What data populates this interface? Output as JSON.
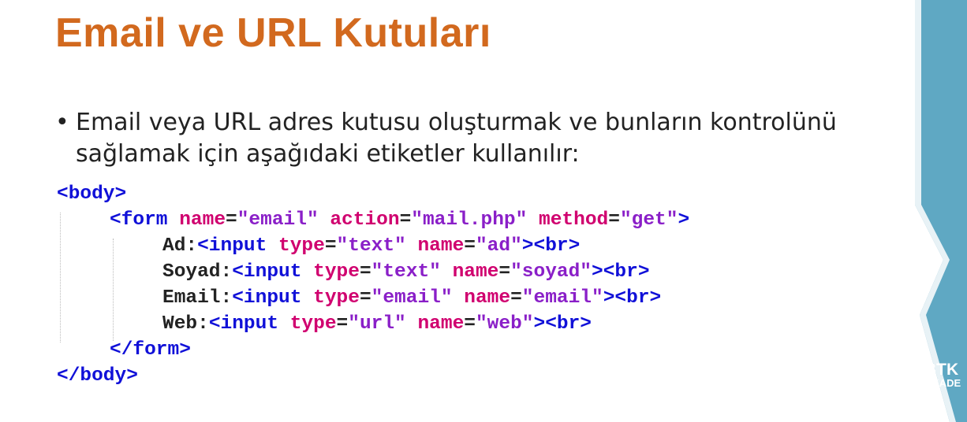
{
  "title": "Email ve URL Kutuları",
  "bullet": {
    "symbol": "•",
    "line1": "Email veya URL adres kutusu oluşturmak ve bunların kontrolünü",
    "line2": "sağlamak için aşağıdaki etiketler kullanılır:"
  },
  "code_lines": [
    [
      {
        "t": "tag",
        "v": "<body>"
      }
    ],
    [
      {
        "t": "tag",
        "v": "<form"
      },
      {
        "t": "txt",
        "v": " "
      },
      {
        "t": "attr",
        "v": "name"
      },
      {
        "t": "txt",
        "v": "="
      },
      {
        "t": "val",
        "v": "\"email\""
      },
      {
        "t": "txt",
        "v": " "
      },
      {
        "t": "attr",
        "v": "action"
      },
      {
        "t": "txt",
        "v": "="
      },
      {
        "t": "val",
        "v": "\"mail.php\""
      },
      {
        "t": "txt",
        "v": " "
      },
      {
        "t": "attr",
        "v": "method"
      },
      {
        "t": "txt",
        "v": "="
      },
      {
        "t": "val",
        "v": "\"get\""
      },
      {
        "t": "tag",
        "v": ">"
      }
    ],
    [
      {
        "t": "txt",
        "v": "Ad:"
      },
      {
        "t": "tag",
        "v": "<input"
      },
      {
        "t": "txt",
        "v": " "
      },
      {
        "t": "attr",
        "v": "type"
      },
      {
        "t": "txt",
        "v": "="
      },
      {
        "t": "val",
        "v": "\"text\""
      },
      {
        "t": "txt",
        "v": " "
      },
      {
        "t": "attr",
        "v": "name"
      },
      {
        "t": "txt",
        "v": "="
      },
      {
        "t": "val",
        "v": "\"ad\""
      },
      {
        "t": "tag",
        "v": "><br>"
      }
    ],
    [
      {
        "t": "txt",
        "v": "Soyad:"
      },
      {
        "t": "tag",
        "v": "<input"
      },
      {
        "t": "txt",
        "v": " "
      },
      {
        "t": "attr",
        "v": "type"
      },
      {
        "t": "txt",
        "v": "="
      },
      {
        "t": "val",
        "v": "\"text\""
      },
      {
        "t": "txt",
        "v": " "
      },
      {
        "t": "attr",
        "v": "name"
      },
      {
        "t": "txt",
        "v": "="
      },
      {
        "t": "val",
        "v": "\"soyad\""
      },
      {
        "t": "tag",
        "v": "><br>"
      }
    ],
    [
      {
        "t": "txt",
        "v": "Email:"
      },
      {
        "t": "tag",
        "v": "<input"
      },
      {
        "t": "txt",
        "v": " "
      },
      {
        "t": "attr",
        "v": "type"
      },
      {
        "t": "txt",
        "v": "="
      },
      {
        "t": "val",
        "v": "\"email\""
      },
      {
        "t": "txt",
        "v": " "
      },
      {
        "t": "attr",
        "v": "name"
      },
      {
        "t": "txt",
        "v": "="
      },
      {
        "t": "val",
        "v": "\"email\""
      },
      {
        "t": "tag",
        "v": "><br>"
      }
    ],
    [
      {
        "t": "txt",
        "v": "Web:"
      },
      {
        "t": "tag",
        "v": "<input"
      },
      {
        "t": "txt",
        "v": " "
      },
      {
        "t": "attr",
        "v": "type"
      },
      {
        "t": "txt",
        "v": "="
      },
      {
        "t": "val",
        "v": "\"url\""
      },
      {
        "t": "txt",
        "v": " "
      },
      {
        "t": "attr",
        "v": "name"
      },
      {
        "t": "txt",
        "v": "="
      },
      {
        "t": "val",
        "v": "\"web\""
      },
      {
        "t": "tag",
        "v": "><br>"
      }
    ],
    [
      {
        "t": "tag",
        "v": "</form>"
      }
    ],
    [
      {
        "t": "tag",
        "v": "</body>"
      }
    ]
  ],
  "code_indent_levels": [
    0,
    1,
    2,
    2,
    2,
    2,
    1,
    0
  ],
  "logo": {
    "line1": "BTK",
    "line2": "AKADE"
  },
  "colors": {
    "title": "#d2691e",
    "tag": "#1010d8",
    "attr": "#d0006f",
    "value": "#8a1fc8",
    "accent_bar": "#5fa8c3"
  }
}
